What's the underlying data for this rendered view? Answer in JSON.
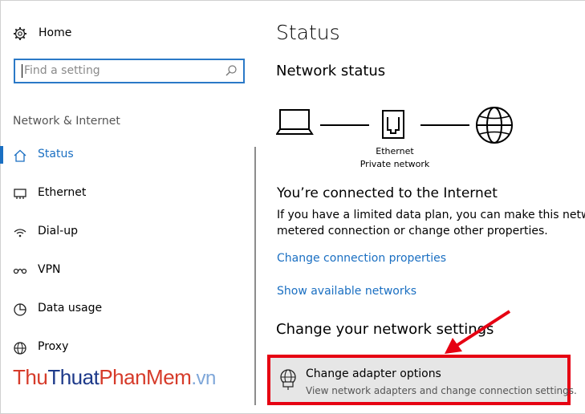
{
  "sidebar": {
    "home_label": "Home",
    "search_placeholder": "Find a setting",
    "section_label": "Network & Internet",
    "items": [
      {
        "label": "Status",
        "icon": "home-status-icon"
      },
      {
        "label": "Ethernet",
        "icon": "ethernet-icon"
      },
      {
        "label": "Dial-up",
        "icon": "dialup-icon"
      },
      {
        "label": "VPN",
        "icon": "vpn-icon"
      },
      {
        "label": "Data usage",
        "icon": "data-usage-icon"
      },
      {
        "label": "Proxy",
        "icon": "proxy-icon"
      }
    ]
  },
  "main": {
    "page_title": "Status",
    "network_status_title": "Network status",
    "diagram": {
      "adapter_name": "Ethernet",
      "network_type": "Private network"
    },
    "connected_title": "You’re connected to the Internet",
    "connected_desc_line1": "If you have a limited data plan, you can make this network",
    "connected_desc_line2": "metered connection or change other properties.",
    "links": {
      "change_connection": "Change connection properties",
      "show_networks": "Show available networks"
    },
    "change_settings_title": "Change your network settings",
    "adapter_option": {
      "title": "Change adapter options",
      "description": "View network adapters and change connection settings."
    }
  },
  "watermark": {
    "part1": "Thu",
    "part2": "Thuat",
    "part3": "PhanMem",
    "part4": ".vn"
  },
  "colors": {
    "accent": "#1a6fc2",
    "highlight_border": "#e60012",
    "arrow": "#e60012"
  }
}
